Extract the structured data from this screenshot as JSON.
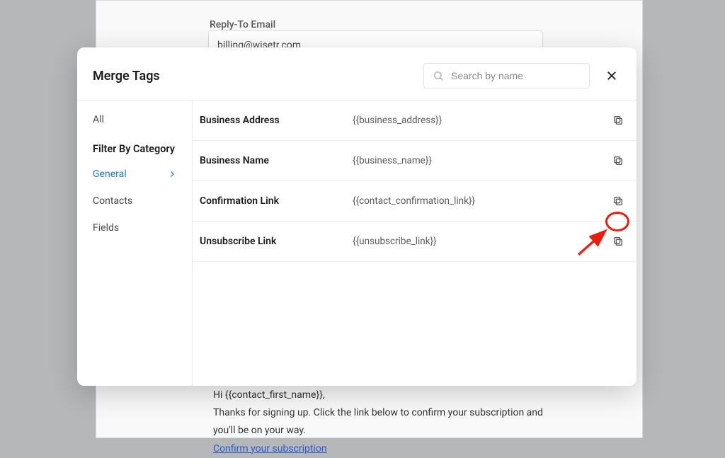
{
  "background": {
    "reply_label": "Reply-To Email",
    "reply_value": "billing@wisetr.com",
    "body_greeting": "Hi {{contact_first_name}},",
    "body_line": "Thanks for signing up. Click the link below to confirm your subscription and you'll be on your way.",
    "confirm_link": "Confirm your subscription"
  },
  "modal": {
    "title": "Merge Tags",
    "search_placeholder": "Search by name"
  },
  "sidebar": {
    "all": "All",
    "filter_heading": "Filter By Category",
    "items": [
      {
        "label": "General",
        "active": true
      },
      {
        "label": "Contacts",
        "active": false
      },
      {
        "label": "Fields",
        "active": false
      }
    ]
  },
  "rows": [
    {
      "name": "Business Address",
      "value": "{{business_address}}"
    },
    {
      "name": "Business Name",
      "value": "{{business_name}}"
    },
    {
      "name": "Confirmation Link",
      "value": "{{contact_confirmation_link}}"
    },
    {
      "name": "Unsubscribe Link",
      "value": "{{unsubscribe_link}}"
    }
  ]
}
